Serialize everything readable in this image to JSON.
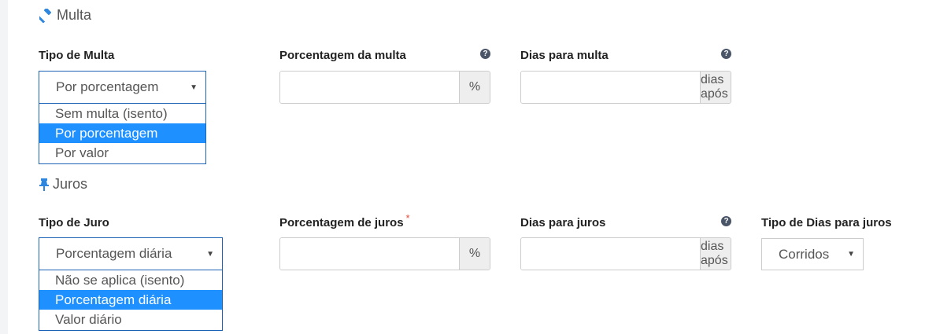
{
  "multa": {
    "section_title": "Multa",
    "tipo": {
      "label": "Tipo de Multa",
      "selected": "Por porcentagem",
      "options": [
        "Sem multa (isento)",
        "Por porcentagem",
        "Por valor"
      ]
    },
    "porcentagem": {
      "label": "Porcentagem da multa",
      "value": "",
      "addon": "%"
    },
    "dias": {
      "label": "Dias para multa",
      "value": "",
      "addon": "dias após"
    }
  },
  "juros": {
    "section_title": "Juros",
    "tipo": {
      "label": "Tipo de Juro",
      "selected": "Porcentagem diária",
      "options": [
        "Não se aplica (isento)",
        "Porcentagem diária",
        "Valor diário"
      ]
    },
    "porcentagem": {
      "label": "Porcentagem de juros",
      "required_mark": "*",
      "value": "",
      "addon": "%"
    },
    "dias": {
      "label": "Dias para juros",
      "value": "",
      "addon": "dias após"
    },
    "tipo_dias": {
      "label": "Tipo de Dias para juros",
      "selected": "Corridos"
    }
  },
  "help_glyph": "?",
  "caret_glyph": "▼",
  "icons": {
    "multa": "gavel-icon",
    "juros": "thumbtack-icon",
    "help": "question-circle-icon"
  },
  "colors": {
    "accent": "#1c63b7",
    "selected_option": "#1e90ff",
    "required": "#e74c3c"
  }
}
